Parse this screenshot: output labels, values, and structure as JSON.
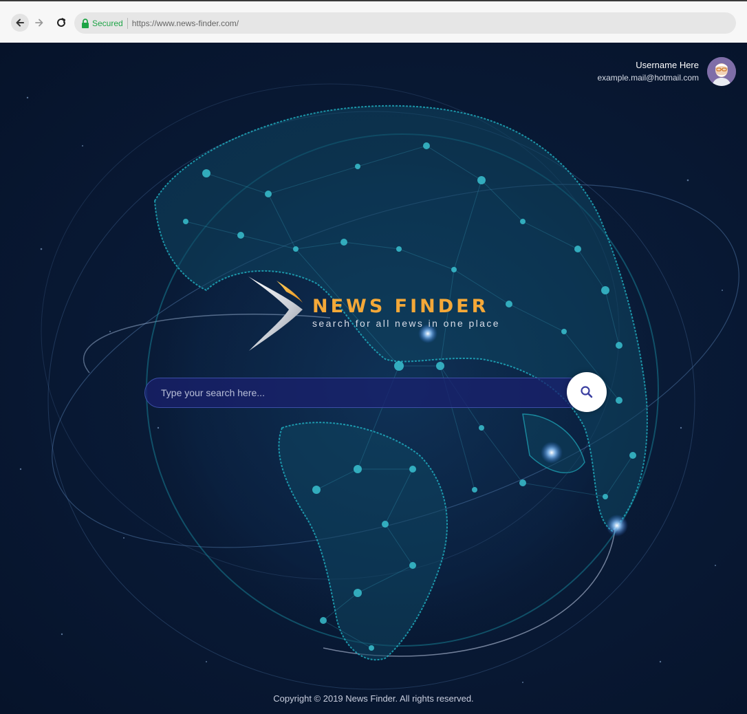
{
  "browser": {
    "secured_label": "Secured",
    "url": "https://www.news-finder.com/"
  },
  "user": {
    "name": "Username Here",
    "email": "example.mail@hotmail.com"
  },
  "brand": {
    "title": "NEWS FINDER",
    "tagline": "search for all news in one place",
    "accent_color": "#f4a838"
  },
  "search": {
    "placeholder": "Type your search here..."
  },
  "footer": {
    "copyright": "Copyright © 2019 News Finder. All rights reserved."
  }
}
